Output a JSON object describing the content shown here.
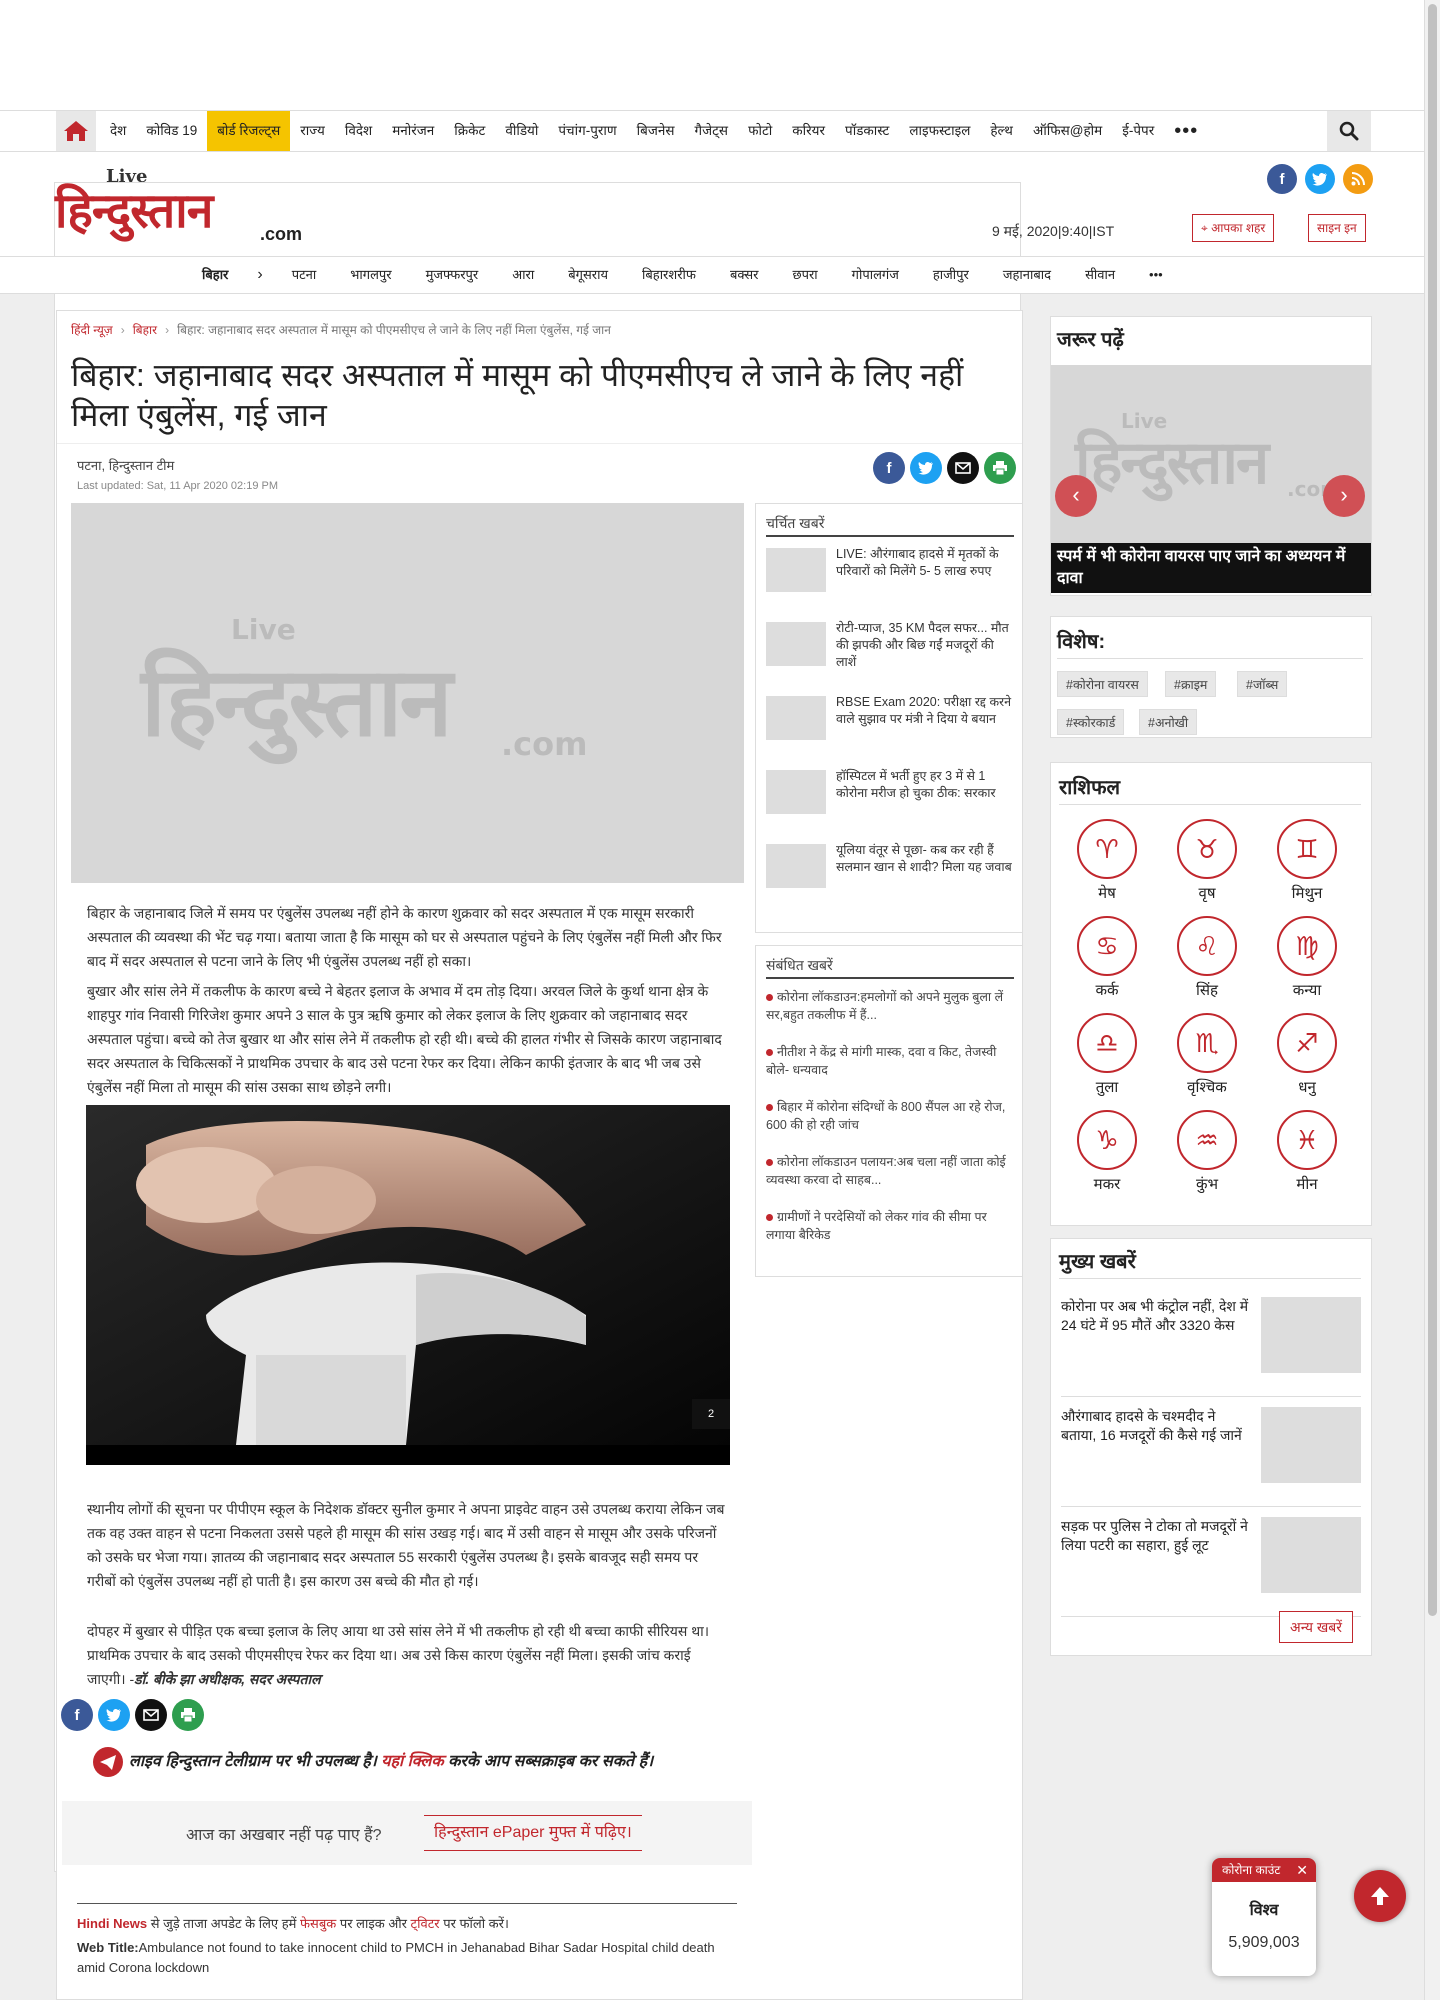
{
  "nav": {
    "items": [
      "देश",
      "कोविड 19",
      "बोर्ड रिजल्ट्स",
      "राज्य",
      "विदेश",
      "मनोरंजन",
      "क्रिकेट",
      "वीडियो",
      "पंचांग-पुराण",
      "बिजनेस",
      "गैजेट्स",
      "फोटो",
      "करियर",
      "पॉडकास्ट",
      "लाइफस्टाइल",
      "हेल्थ",
      "ऑफिस@होम",
      "ई-पेपर"
    ],
    "highlighted": "बोर्ड रिजल्ट्स",
    "more": "•••"
  },
  "header": {
    "logo_live": "Live",
    "logo_main": "हिन्दुस्तान",
    "logo_com": ".com",
    "datetime": "9 मई, 2020|9:40|IST",
    "city_button": "आपका शहर",
    "signin_button": "साइन इन",
    "colors": {
      "brand": "#c1272d",
      "facebook": "#3b5998",
      "twitter": "#1da1f2",
      "rss": "#f39c12"
    }
  },
  "state_nav": {
    "state": "बिहार",
    "arrow": "›",
    "cities": [
      "पटना",
      "भागलपुर",
      "मुजफ्फरपुर",
      "आरा",
      "बेगूसराय",
      "बिहारशरीफ",
      "बक्सर",
      "छपरा",
      "गोपालगंज",
      "हाजीपुर",
      "जहानाबाद",
      "सीवान"
    ],
    "more": "•••"
  },
  "breadcrumb": {
    "home": "हिंदी न्यूज़",
    "section": "बिहार",
    "current": "बिहार: जहानाबाद सदर अस्पताल में मासूम को पीएमसीएच ले जाने के लिए नहीं मिला एंबुलेंस, गई जान"
  },
  "article": {
    "title": "बिहार: जहानाबाद सदर अस्पताल में मासूम को पीएमसीएच ले जाने के लिए नहीं मिला एंबुलेंस, गई जान",
    "place": "पटना, हिन्दुस्तान टीम",
    "updated": "Last updated:  Sat, 11 Apr 2020 02:19 PM",
    "para1": "बिहार के जहानाबाद जिले में समय पर एंबुलेंस उपलब्ध नहीं होने के कारण शुक्रवार को सदर अस्पताल में एक मासूम सरकारी अस्पताल की व्यवस्था की भेंट चढ़ गया। बताया जाता है कि मासूम को घर से अस्पताल पहुंचने के लिए एंबुलेंस नहीं मिली और फिर बाद में सदर अस्पताल से पटना जाने के लिए भी एंबुलेंस उपलब्ध नहीं हो सका।",
    "para2": "बुखार और सांस लेने में तकलीफ के कारण बच्चे ने बेहतर इलाज के अभाव में दम तोड़ दिया। अरवल जिले के कुर्था थाना क्षेत्र के शाहपुर गांव निवासी गिरिजेश कुमार अपने 3 साल के पुत्र ऋषि कुमार को लेकर इलाज के लिए शुक्रवार को जहानाबाद सदर अस्पताल पहुंचा। बच्चे को तेज बुखार था और सांस लेने में तकलीफ हो रही थी। बच्चे की हालत गंभीर से जिसके कारण जहानाबाद सदर अस्पताल के चिकित्सकों ने प्राथमिक उपचार के बाद उसे पटना रेफर कर दिया। लेकिन काफी इंतजार के बाद भी जब उसे एंबुलेंस नहीं मिला तो मासूम की सांस उसका साथ छोड़ने लगी।",
    "video_counter": "2",
    "para3": "स्थानीय लोगों की सूचना पर पीपीएम स्कूल के निदेशक डॉक्टर सुनील कुमार ने अपना प्राइवेट वाहन उसे उपलब्ध कराया लेकिन जब तक वह उक्त वाहन से पटना निकलता उससे पहले ही मासूम की सांस उखड़ गई। बाद में उसी वाहन से मासूम और उसके परिजनों को उसके घर भेजा गया। ज्ञातव्य की जहानाबाद सदर अस्पताल 55 सरकारी एंबुलेंस उपलब्ध है। इसके बावजूद सही समय पर गरीबों को एंबुलेंस उपलब्ध नहीं हो पाती है। इस कारण उस बच्चे की मौत हो गई।",
    "para4": "दोपहर में बुखार से पीड़ित एक बच्चा इलाज के लिए आया था उसे सांस लेने में भी तकलीफ हो रही थी बच्चा काफी सीरियस था। प्राथमिक उपचार के बाद उसको पीएमसीएच रेफर कर दिया था। अब उसे किस कारण एंबुलेंस नहीं मिला। इसकी जांच कराई जाएगी। -",
    "para4_quote": "डॉ. बीके झा अधीक्षक, सदर अस्पताल",
    "telegram_pre": "लाइव हिन्दुस्तान टेलीग्राम पर भी उपलब्ध है।",
    "telegram_link": "यहां क्लिक",
    "telegram_post": "करके आप सब्सक्राइब कर सकते हैं।",
    "epaper_text": "आज का अखबार नहीं पढ़ पाए हैं?",
    "epaper_button": "हिन्दुस्तान ePaper मुफ्त में पढ़िए।",
    "footer_hindi_news": "Hindi News",
    "footer_text1": " से जुड़े ताजा अपडेट के लिए हमें ",
    "footer_fb": "फेसबुक",
    "footer_text2": " पर लाइक और ",
    "footer_tw": "ट्विटर",
    "footer_text3": " पर फॉलो करें।",
    "web_title_label": "Web Title:",
    "web_title": "Ambulance not found to take innocent child to PMCH in Jehanabad Bihar Sadar Hospital child death amid Corona lockdown"
  },
  "trending": {
    "header": "चर्चित खबरें",
    "items": [
      "LIVE: औरंगाबाद हादसे में मृतकों के परिवारों को मिलेंगे 5- 5 लाख रुपए",
      "रोटी-प्याज, 35 KM पैदल सफर... मौत की झपकी और बिछ गईं मजदूरों की लाशें",
      "RBSE Exam 2020: परीक्षा रद्द करने वाले सुझाव पर मंत्री ने दिया ये बयान",
      "हॉस्पिटल में भर्ती हुए हर 3 में से 1 कोरोना मरीज हो चुका ठीक: सरकार",
      "यूलिया वंतूर से पूछा- कब कर रही हैं सलमान खान से शादी? मिला यह जवाब"
    ]
  },
  "related": {
    "header": "संबंधित खबरें",
    "items": [
      "कोरोना लॉकडाउन:हमलोगों को अपने मुलुक बुला लें सर,बहुत तकलीफ में हैं...",
      "नीतीश ने केंद्र से मांगी मास्क, दवा व किट, तेजस्वी बोले- धन्यवाद",
      "बिहार में कोरोना संदिग्धों के 800 सैंपल आ रहे रोज, 600 की हो रही जांच",
      "कोरोना लॉकडाउन पलायन:अब चला नहीं जाता कोई व्यवस्था करवा दो साहब...",
      "ग्रामीणों ने परदेसियों को लेकर गांव की सीमा पर लगाया बैरिकेड"
    ]
  },
  "must_read": {
    "header": "जरूर पढ़ें",
    "caption": "स्पर्म में भी कोरोना वायरस पाए जाने का अध्ययन में दावा",
    "prev": "‹",
    "next": "›"
  },
  "special": {
    "header": "विशेष:",
    "tags": [
      "#कोरोना वायरस",
      "#क्राइम",
      "#जॉब्स",
      "#स्कोरकार्ड",
      "#अनोखी"
    ]
  },
  "rashifal": {
    "header": "राशिफल",
    "signs": [
      {
        "name": "मेष",
        "icon": "♈"
      },
      {
        "name": "वृष",
        "icon": "♉"
      },
      {
        "name": "मिथुन",
        "icon": "♊"
      },
      {
        "name": "कर्क",
        "icon": "♋"
      },
      {
        "name": "सिंह",
        "icon": "♌"
      },
      {
        "name": "कन्या",
        "icon": "♍"
      },
      {
        "name": "तुला",
        "icon": "♎"
      },
      {
        "name": "वृश्चिक",
        "icon": "♏"
      },
      {
        "name": "धनु",
        "icon": "♐"
      },
      {
        "name": "मकर",
        "icon": "♑"
      },
      {
        "name": "कुंभ",
        "icon": "♒"
      },
      {
        "name": "मीन",
        "icon": "♓"
      }
    ]
  },
  "top_news": {
    "header": "मुख्य खबरें",
    "items": [
      "कोरोना पर अब भी कंट्रोल नहीं, देश में 24 घंटे में 95 मौतें और 3320 केस",
      "औरंगाबाद हादसे के चश्मदीद ने बताया, 16 मजदूरों की कैसे गई जानें",
      "सड़क पर पुलिस ने टोका तो मजदूरों ने लिया पटरी का सहारा, हुई लूट"
    ],
    "more_button": "अन्य खबरें"
  },
  "corona_widget": {
    "title": "कोरोना काउंट",
    "close": "✕",
    "label": "विश्व",
    "value": "5,909,003"
  },
  "icons": {
    "home": "home-icon",
    "search": "search-icon",
    "to_top": "arrow-up-icon"
  }
}
